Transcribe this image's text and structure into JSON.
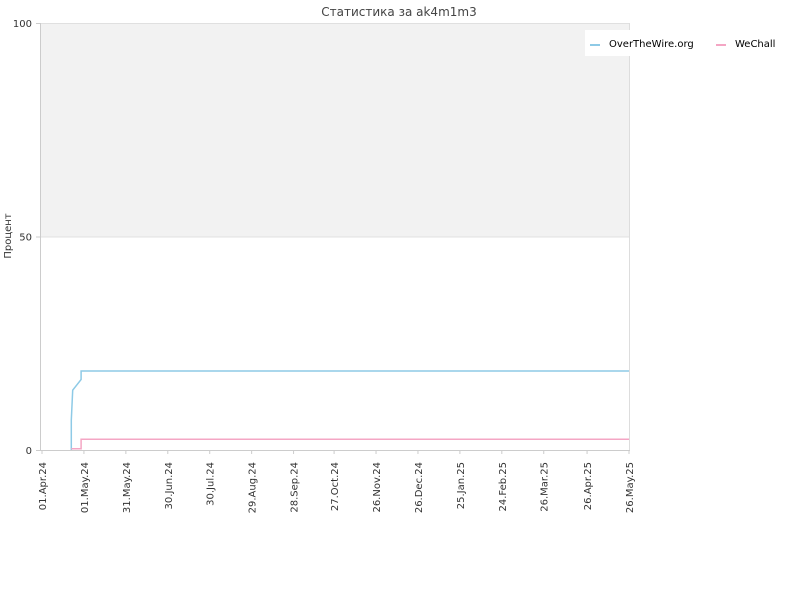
{
  "chart_data": {
    "type": "line",
    "title": "Статистика за ak4m1m3",
    "ylabel": "Процент",
    "xlabel": "",
    "ylim": [
      0,
      100
    ],
    "xlim": [
      "2024-04-01",
      "2025-05-26"
    ],
    "y_ticks": [
      "0",
      "50",
      "100"
    ],
    "y_tick_values": [
      0,
      50,
      100
    ],
    "x_ticks": [
      {
        "label": "01.Apr.24",
        "date": "2024-04-01"
      },
      {
        "label": "01.May.24",
        "date": "2024-05-01"
      },
      {
        "label": "31.May.24",
        "date": "2024-05-31"
      },
      {
        "label": "30.Jun.24",
        "date": "2024-06-30"
      },
      {
        "label": "30.Jul.24",
        "date": "2024-07-30"
      },
      {
        "label": "29.Aug.24",
        "date": "2024-08-29"
      },
      {
        "label": "28.Sep.24",
        "date": "2024-09-28"
      },
      {
        "label": "27.Oct.24",
        "date": "2024-10-27"
      },
      {
        "label": "26.Nov.24",
        "date": "2024-11-26"
      },
      {
        "label": "26.Dec.24",
        "date": "2024-12-26"
      },
      {
        "label": "25.Jan.25",
        "date": "2025-01-25"
      },
      {
        "label": "24.Feb.25",
        "date": "2025-02-24"
      },
      {
        "label": "26.Mar.25",
        "date": "2025-03-26"
      },
      {
        "label": "26.Apr.25",
        "date": "2025-04-26"
      },
      {
        "label": "26.May.25",
        "date": "2025-05-26"
      }
    ],
    "grid": true,
    "shaded_band": [
      50,
      100
    ],
    "legend_position": "top-right",
    "series": [
      {
        "name": "OverTheWire.org",
        "color": "#8ecae6",
        "points": [
          {
            "x": "2024-04-22",
            "y": 0
          },
          {
            "x": "2024-04-22",
            "y": 7
          },
          {
            "x": "2024-04-23",
            "y": 14
          },
          {
            "x": "2024-04-29",
            "y": 16.5
          },
          {
            "x": "2024-04-29",
            "y": 18.5
          },
          {
            "x": "2025-05-26",
            "y": 18.5
          }
        ]
      },
      {
        "name": "WeChall",
        "color": "#f4a6c4",
        "points": [
          {
            "x": "2024-04-22",
            "y": 0.3
          },
          {
            "x": "2024-04-29",
            "y": 0.3
          },
          {
            "x": "2024-04-29",
            "y": 2.5
          },
          {
            "x": "2025-05-26",
            "y": 2.5
          }
        ]
      }
    ]
  }
}
